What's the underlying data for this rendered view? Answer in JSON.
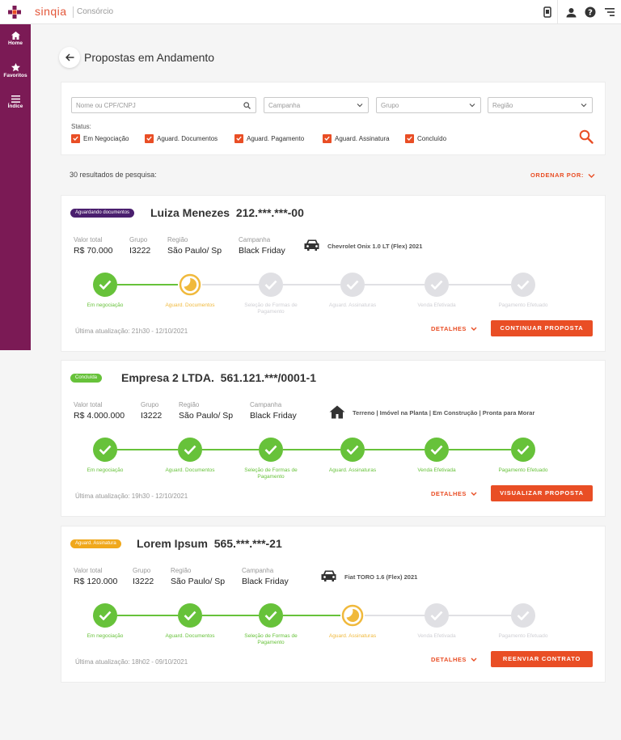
{
  "header": {
    "brand": "sinqia",
    "product": "Consórcio"
  },
  "sidebar": {
    "items": [
      {
        "label": "Home"
      },
      {
        "label": "Favoritos"
      },
      {
        "label": "Índice"
      }
    ]
  },
  "page": {
    "title": "Propostas em Andamento"
  },
  "filters": {
    "search_placeholder": "Nome ou CPF/CNPJ",
    "campaign_placeholder": "Campanha",
    "group_placeholder": "Grupo",
    "region_placeholder": "Região",
    "status_label": "Status:",
    "statuses": [
      {
        "label": "Em Negociação",
        "checked": true
      },
      {
        "label": "Aguard. Documentos",
        "checked": true
      },
      {
        "label": "Aguard. Pagamento",
        "checked": true
      },
      {
        "label": "Aguard. Assinatura",
        "checked": true
      },
      {
        "label": "Concluído",
        "checked": true
      }
    ]
  },
  "results": {
    "count_text": "30 resultados de pesquisa:",
    "order_label": "ORDENAR POR:"
  },
  "steps": [
    "Em negociação",
    "Aguard. Documentos",
    "Seleção de Formas de Pagamento",
    "Aguard. Assinaturas",
    "Venda Efetivada",
    "Pagamento Efetuado"
  ],
  "labels": {
    "valor": "Valor total",
    "grupo": "Grupo",
    "regiao": "Região",
    "campanha": "Campanha",
    "detalhes": "DETALHES"
  },
  "colors": {
    "accent": "#e94e25",
    "sidebar": "#7b1a55",
    "done": "#67c23a",
    "pending": "#f0b93c",
    "todo": "#e0e0e4"
  },
  "cards": [
    {
      "badge": "Aguardando documentos",
      "badge_color": "#4a1f6e",
      "name": "Luiza Menezes",
      "doc": "212.***.***-00",
      "valor": "R$ 70.000",
      "grupo": "I3222",
      "regiao": "São Paulo/ Sp",
      "campanha": "Black Friday",
      "product_icon": "car-icon",
      "product": "Chevrolet Onix 1.0 LT (Flex) 2021",
      "step_states": [
        "done",
        "pending",
        "todo",
        "todo",
        "todo",
        "todo"
      ],
      "updated": "Última atualização: 21h30 - 12/10/2021",
      "cta": "CONTINUAR PROPOSTA"
    },
    {
      "badge": "Concluída",
      "badge_color": "#67c23a",
      "name": "Empresa 2 LTDA.",
      "doc": "561.121.***/0001-1",
      "valor": "R$ 4.000.000",
      "grupo": "I3222",
      "regiao": "São Paulo/ Sp",
      "campanha": "Black Friday",
      "product_icon": "house-icon",
      "product": "Terreno | Imóvel na Planta | Em Construção | Pronta para Morar",
      "step_states": [
        "done",
        "done",
        "done",
        "done",
        "done",
        "done"
      ],
      "updated": "Última atualização: 19h30 - 12/10/2021",
      "cta": "VISUALIZAR PROPOSTA"
    },
    {
      "badge": "Aguard. Assinatura",
      "badge_color": "#f0a81c",
      "name": "Lorem Ipsum",
      "doc": "565.***.***-21",
      "valor": "R$ 120.000",
      "grupo": "I3222",
      "regiao": "São Paulo/ Sp",
      "campanha": "Black Friday",
      "product_icon": "car-icon",
      "product": "Fiat TORO 1.6 (Flex) 2021",
      "step_states": [
        "done",
        "done",
        "done",
        "pending",
        "todo",
        "todo"
      ],
      "updated": "Última atualização: 18h02 - 09/10/2021",
      "cta": "REENVIAR CONTRATO"
    }
  ]
}
